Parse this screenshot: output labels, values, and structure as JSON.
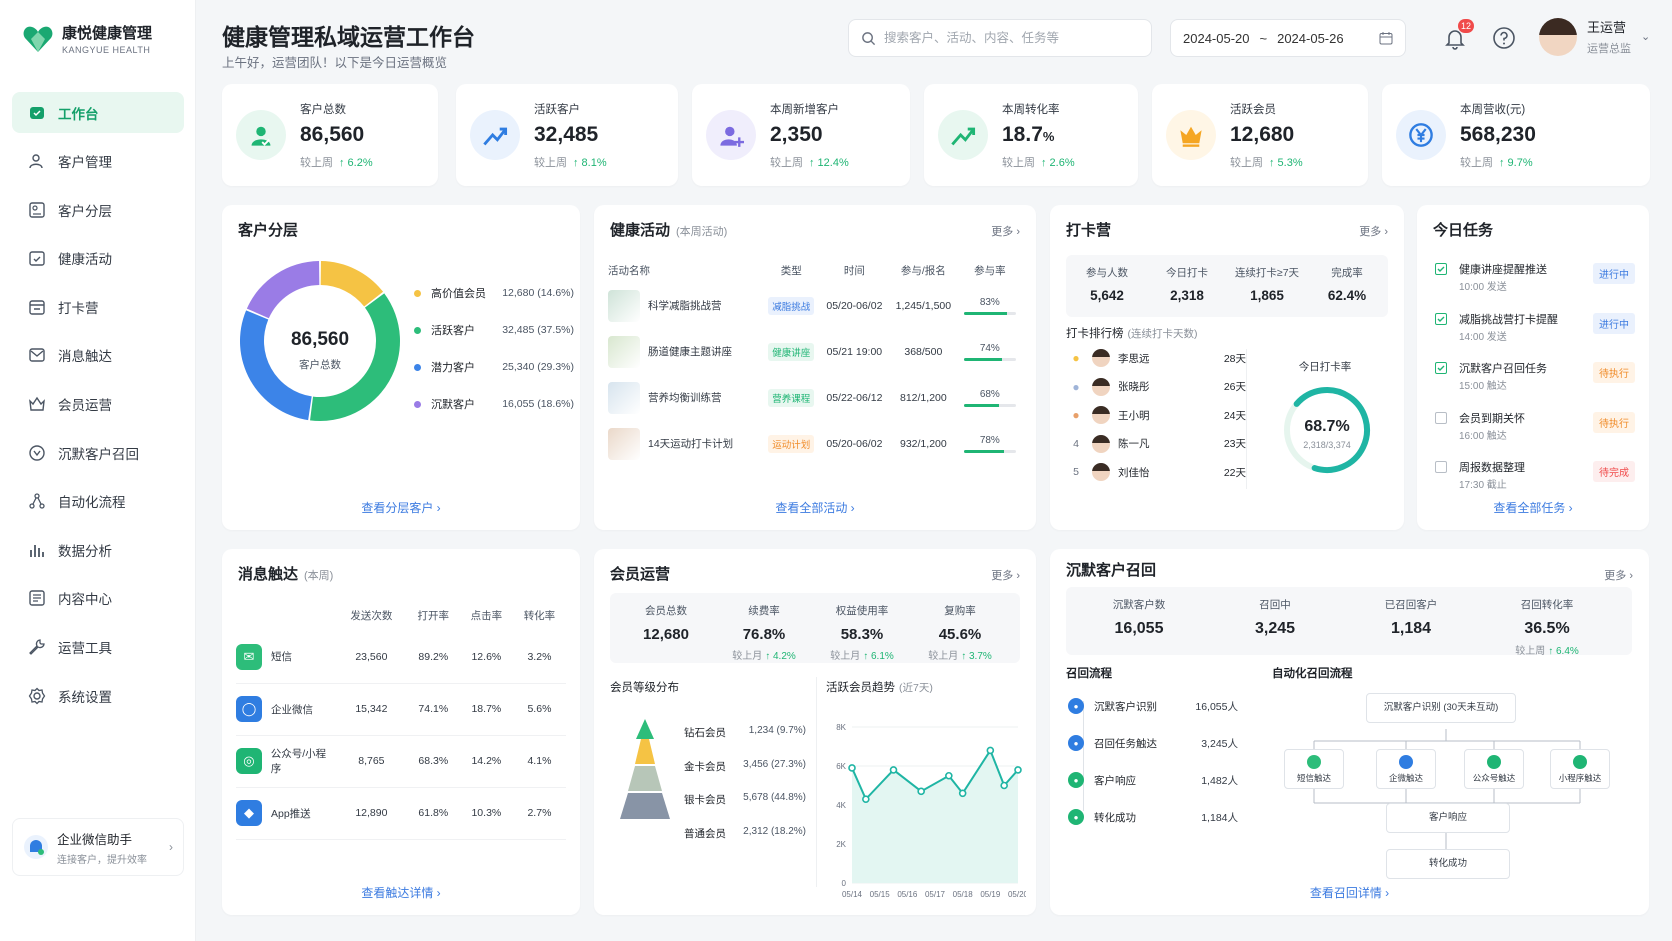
{
  "app": {
    "name_cn": "康悦健康管理",
    "name_en": "KANGYUE HEALTH"
  },
  "nav": [
    {
      "label": "工作台",
      "icon": "workbench-icon",
      "active": true
    },
    {
      "label": "客户管理",
      "icon": "users-icon"
    },
    {
      "label": "客户分层",
      "icon": "layers-icon"
    },
    {
      "label": "健康活动",
      "icon": "calendar-icon"
    },
    {
      "label": "打卡营",
      "icon": "checkin-icon"
    },
    {
      "label": "消息触达",
      "icon": "message-icon"
    },
    {
      "label": "会员运营",
      "icon": "crown-icon"
    },
    {
      "label": "沉默客户召回",
      "icon": "recall-icon"
    },
    {
      "label": "自动化流程",
      "icon": "flow-icon"
    },
    {
      "label": "数据分析",
      "icon": "bar-chart-icon"
    },
    {
      "label": "内容中心",
      "icon": "content-icon"
    },
    {
      "label": "运营工具",
      "icon": "tool-icon"
    },
    {
      "label": "系统设置",
      "icon": "gear-icon"
    }
  ],
  "assistant": {
    "title": "企业微信助手",
    "subtitle": "连接客户，提升效率"
  },
  "header": {
    "title": "健康管理私域运营工作台",
    "subtitle": "上午好，运营团队！以下是今日运营概览",
    "search_placeholder": "搜索客户、活动、内容、任务等",
    "date_start": "2024-05-20",
    "date_sep": "~",
    "date_end": "2024-05-26",
    "notif_count": "12",
    "user_name": "王运营",
    "user_role": "运营总监"
  },
  "kpis": [
    {
      "label": "客户总数",
      "value": "86,560",
      "unit": "",
      "cmp_label": "较上周",
      "change": "↑ 6.2%",
      "color": "#1fb574",
      "bg": "#e8f7f0",
      "icon": "users-icon"
    },
    {
      "label": "活跃客户",
      "value": "32,485",
      "unit": "",
      "cmp_label": "较上周",
      "change": "↑ 8.1%",
      "color": "#2f7de1",
      "bg": "#eaf2fd",
      "icon": "trend-up-icon"
    },
    {
      "label": "本周新增客户",
      "value": "2,350",
      "unit": "",
      "cmp_label": "较上周",
      "change": "↑ 12.4%",
      "color": "#7c6be0",
      "bg": "#f0eefc",
      "icon": "user-add-icon"
    },
    {
      "label": "本周转化率",
      "value": "18.7",
      "unit": "%",
      "cmp_label": "较上周",
      "change": "↑ 2.6%",
      "color": "#1fb574",
      "bg": "#e8f7f0",
      "icon": "trend-up-icon"
    },
    {
      "label": "活跃会员",
      "value": "12,680",
      "unit": "",
      "cmp_label": "较上周",
      "change": "↑ 5.3%",
      "color": "#f5a623",
      "bg": "#fff6e6",
      "icon": "crown-icon"
    },
    {
      "label": "本周营收(元)",
      "value": "568,230",
      "unit": "",
      "cmp_label": "较上周",
      "change": "↑ 9.7%",
      "color": "#2f7de1",
      "bg": "#eaf2fd",
      "icon": "yen-icon"
    }
  ],
  "segment": {
    "title": "客户分层",
    "center_value": "86,560",
    "center_label": "客户总数",
    "link": "查看分层客户 ›",
    "items": [
      {
        "label": "高价值会员",
        "value": "12,680 (14.6%)",
        "num": 12680,
        "color": "#f5c344"
      },
      {
        "label": "活跃客户",
        "value": "32,485 (37.5%)",
        "num": 32485,
        "color": "#2dbd7a"
      },
      {
        "label": "潜力客户",
        "value": "25,340 (29.3%)",
        "num": 25340,
        "color": "#3c84e8"
      },
      {
        "label": "沉默客户",
        "value": "16,055 (18.6%)",
        "num": 16055,
        "color": "#9a7ce6"
      }
    ]
  },
  "activities": {
    "title": "健康活动",
    "sub": "(本周活动)",
    "more": "更多 ›",
    "link": "查看全部活动 ›",
    "headers": [
      "活动名称",
      "类型",
      "时间",
      "参与/报名",
      "参与率"
    ],
    "rows": [
      {
        "name": "科学减脂挑战营",
        "type": "减脂挑战",
        "tag_color": "#3c7be0",
        "tag_bg": "#eaf1fd",
        "time": "05/20-06/02",
        "ratio": "1,245/1,500",
        "rate": "83%",
        "pct": 83
      },
      {
        "name": "肠道健康主题讲座",
        "type": "健康讲座",
        "tag_color": "#1fb574",
        "tag_bg": "#e8f7f0",
        "time": "05/21 19:00",
        "ratio": "368/500",
        "rate": "74%",
        "pct": 74
      },
      {
        "name": "营养均衡训练营",
        "type": "营养课程",
        "tag_color": "#1fb574",
        "tag_bg": "#e8f7f0",
        "time": "05/22-06/12",
        "ratio": "812/1,200",
        "rate": "68%",
        "pct": 68
      },
      {
        "name": "14天运动打卡计划",
        "type": "运动计划",
        "tag_color": "#f08c2a",
        "tag_bg": "#fff3e6",
        "time": "05/20-06/02",
        "ratio": "932/1,200",
        "rate": "78%",
        "pct": 78
      }
    ]
  },
  "camp": {
    "title": "打卡营",
    "more": "更多 ›",
    "stats": [
      {
        "label": "参与人数",
        "value": "5,642"
      },
      {
        "label": "今日打卡",
        "value": "2,318"
      },
      {
        "label": "连续打卡≥7天",
        "value": "1,865"
      },
      {
        "label": "完成率",
        "value": "62.4%"
      }
    ],
    "rank_title": "打卡排行榜",
    "rank_sub": "(连续打卡天数)",
    "rank": [
      {
        "no": "1",
        "name": "李思远",
        "days": "28天"
      },
      {
        "no": "2",
        "name": "张晓彤",
        "days": "26天"
      },
      {
        "no": "3",
        "name": "王小明",
        "days": "24天"
      },
      {
        "no": "4",
        "name": "陈一凡",
        "days": "23天"
      },
      {
        "no": "5",
        "name": "刘佳怡",
        "days": "22天"
      }
    ],
    "gauge_label": "今日打卡率",
    "gauge_value": "68.7%",
    "gauge_pct": 68.7,
    "gauge_sub": "2,318/3,374"
  },
  "tasks": {
    "title": "今日任务",
    "link": "查看全部任务 ›",
    "items": [
      {
        "title": "健康讲座提醒推送",
        "time": "10:00 发送",
        "status": "进行中",
        "done": true,
        "color": "#3c7be0",
        "bg": "#eaf1fd"
      },
      {
        "title": "减脂挑战营打卡提醒",
        "time": "14:00 发送",
        "status": "进行中",
        "done": true,
        "color": "#3c7be0",
        "bg": "#eaf1fd"
      },
      {
        "title": "沉默客户召回任务",
        "time": "15:00 触达",
        "status": "待执行",
        "done": true,
        "color": "#f08c2a",
        "bg": "#fff3e6"
      },
      {
        "title": "会员到期关怀",
        "time": "16:00 触达",
        "status": "待执行",
        "done": false,
        "color": "#f08c2a",
        "bg": "#fff3e6"
      },
      {
        "title": "周报数据整理",
        "time": "17:30 截止",
        "status": "待完成",
        "done": false,
        "color": "#f04a4a",
        "bg": "#fdeeee"
      }
    ]
  },
  "messages": {
    "title": "消息触达",
    "sub": "(本周)",
    "link": "查看触达详情 ›",
    "headers": [
      "发送次数",
      "打开率",
      "点击率",
      "转化率"
    ],
    "rows": [
      {
        "channel": "短信",
        "color": "#2dbd7a",
        "glyph": "✉",
        "sent": "23,560",
        "open": "89.2%",
        "click": "12.6%",
        "conv": "3.2%"
      },
      {
        "channel": "企业微信",
        "color": "#2f7de1",
        "glyph": "◯",
        "sent": "15,342",
        "open": "74.1%",
        "click": "18.7%",
        "conv": "5.6%"
      },
      {
        "channel": "公众号/小程序",
        "color": "#1fb574",
        "glyph": "◎",
        "sent": "8,765",
        "open": "68.3%",
        "click": "14.2%",
        "conv": "4.1%"
      },
      {
        "channel": "App推送",
        "color": "#2f7de1",
        "glyph": "◆",
        "sent": "12,890",
        "open": "61.8%",
        "click": "10.3%",
        "conv": "2.7%"
      }
    ]
  },
  "member": {
    "title": "会员运营",
    "more": "更多 ›",
    "stats": [
      {
        "label": "会员总数",
        "value": "12,680",
        "cmp": "",
        "chg": ""
      },
      {
        "label": "续费率",
        "value": "76.8%",
        "cmp": "较上月",
        "chg": "↑ 4.2%"
      },
      {
        "label": "权益使用率",
        "value": "58.3%",
        "cmp": "较上月",
        "chg": "↑ 6.1%"
      },
      {
        "label": "复购率",
        "value": "45.6%",
        "cmp": "较上月",
        "chg": "↑ 3.7%"
      }
    ],
    "levels_title": "会员等级分布",
    "levels": [
      {
        "name": "钻石会员",
        "value": "1,234 (9.7%)",
        "color": "#2dbd7a"
      },
      {
        "name": "金卡会员",
        "value": "3,456 (27.3%)",
        "color": "#f5c344"
      },
      {
        "name": "银卡会员",
        "value": "5,678 (44.8%)",
        "color": "#b7c6b8"
      },
      {
        "name": "普通会员",
        "value": "2,312 (18.2%)",
        "color": "#8894a6"
      }
    ],
    "trend_title": "活跃会员趋势",
    "trend_sub": "(近7天)"
  },
  "chart_data": {
    "type": "line",
    "title": "活跃会员趋势",
    "x": [
      "05/14",
      "05/15",
      "05/16",
      "05/17",
      "05/18",
      "05/19",
      "05/20"
    ],
    "values": [
      5900,
      4300,
      5800,
      4700,
      5500,
      4600,
      6800,
      5000,
      5800
    ],
    "x_points": [
      0,
      0.5,
      1.5,
      2.5,
      3.5,
      4,
      5,
      5.5,
      6.0
    ],
    "yticks": [
      "0",
      "2K",
      "4K",
      "6K",
      "8K"
    ],
    "ylim": [
      0,
      8000
    ],
    "color": "#1fb5a4"
  },
  "recall": {
    "title": "沉默客户召回",
    "more": "更多 ›",
    "link": "查看召回详情 ›",
    "stats": [
      {
        "label": "沉默客户数",
        "value": "16,055",
        "cmp": "",
        "chg": ""
      },
      {
        "label": "召回中",
        "value": "3,245",
        "cmp": "",
        "chg": ""
      },
      {
        "label": "已召回客户",
        "value": "1,184",
        "cmp": "",
        "chg": ""
      },
      {
        "label": "召回转化率",
        "value": "36.5%",
        "cmp": "较上周",
        "chg": "↑ 6.4%"
      }
    ],
    "flow_title": "召回流程",
    "steps": [
      {
        "label": "沉默客户识别",
        "value": "16,055人"
      },
      {
        "label": "召回任务触达",
        "value": "3,245人"
      },
      {
        "label": "客户响应",
        "value": "1,482人"
      },
      {
        "label": "转化成功",
        "value": "1,184人"
      }
    ],
    "auto_title": "自动化召回流程",
    "auto_root": "沉默客户识别 (30天未互动)",
    "channels": [
      "短信触达",
      "企微触达",
      "公众号触达",
      "小程序触达"
    ],
    "response": "客户响应",
    "success": "转化成功"
  }
}
